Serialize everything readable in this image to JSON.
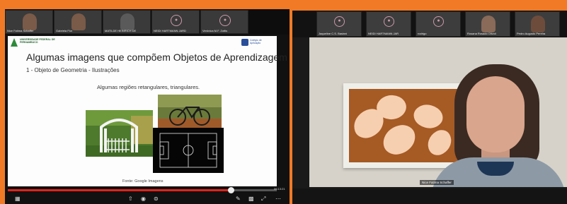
{
  "left_panel": {
    "thumbnails": [
      {
        "name": "Nice Fatima Schaffer",
        "type": "video"
      },
      {
        "name": "Gabriela Flor",
        "type": "video"
      },
      {
        "name": "MATILDE HEINRICH DE",
        "type": "video"
      },
      {
        "name": "NEIDI HARTMANN JARD",
        "type": "avatar"
      },
      {
        "name": "Verônica M.F. Zottis",
        "type": "avatar"
      }
    ],
    "slide": {
      "logo_left_text": "UNIVERSIDADE FEDERAL DE PERNAMBUCO",
      "logo_right_text": "Colégio de Aplicação",
      "title": "Algumas imagens que compõem Objetos de Aprendizagem",
      "subtitle": "1 - Objeto de Geometria - Ilustrações",
      "caption": "Algumas regiões retangulares, triangulares.",
      "source": "Fonte: Google Imagens"
    },
    "player": {
      "progress": 0.83,
      "timecode": "06:13:21"
    },
    "controls": {
      "menu_icon": "▦",
      "share_icon": "⇧",
      "volume_icon": "◉",
      "cc_icon": "⊜",
      "pen_icon": "✎",
      "grid_icon": "▩",
      "expand_icon": "⤢",
      "more_icon": "⋯"
    }
  },
  "right_panel": {
    "thumbnails": [
      {
        "name": "Jaqueline C.S. Basinni",
        "type": "avatar"
      },
      {
        "name": "NEIDI HARTMANN JAR",
        "type": "avatar"
      },
      {
        "name": "rodrigo",
        "type": "avatar"
      },
      {
        "name": "Rosana Rosado Olivoli",
        "type": "video"
      },
      {
        "name": "Pedro Augusto Pereira",
        "type": "video"
      }
    ],
    "speaker_name": "Nice Fatima Schaffer"
  },
  "colors": {
    "border_accent": "#f07a26",
    "progress_played": "#e2231a"
  }
}
